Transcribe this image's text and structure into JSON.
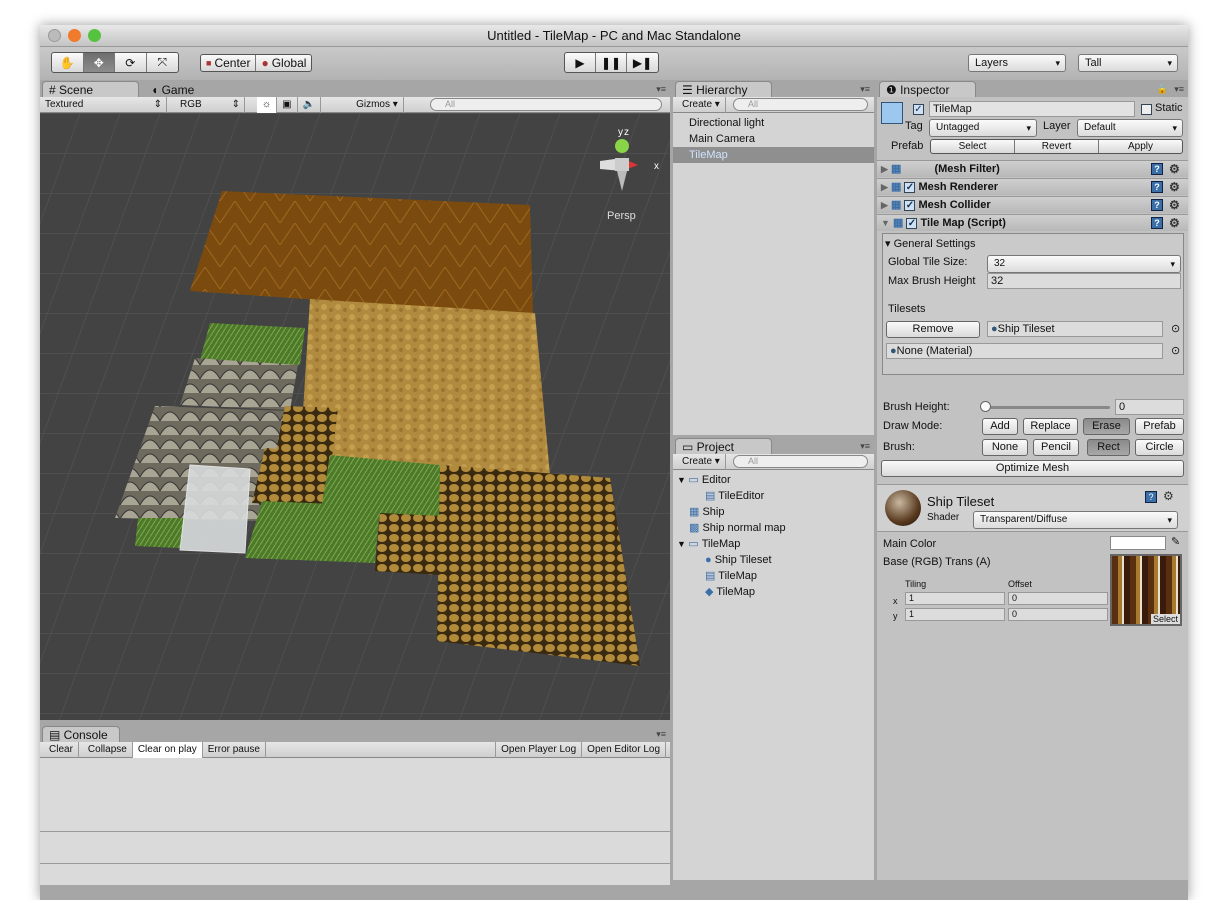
{
  "window": {
    "title": "Untitled - TileMap - PC and Mac Standalone"
  },
  "toolbar": {
    "tools": [
      "hand-tool",
      "move-tool",
      "rotate-tool",
      "scale-tool"
    ],
    "active_tool": "move-tool",
    "pivot": "Center",
    "space": "Global",
    "play": "play",
    "pause": "pause",
    "step": "step",
    "layers": "Layers",
    "layout": "Tall"
  },
  "scene": {
    "tabs": [
      {
        "label": "Scene",
        "active": true
      },
      {
        "label": "Game",
        "active": false
      }
    ],
    "render_mode": "Textured",
    "channel": "RGB",
    "gizmos": "Gizmos",
    "search_placeholder": "All",
    "view_label": "Persp",
    "gizmo_axes": {
      "y": "y",
      "z": "z",
      "x": "x"
    }
  },
  "console": {
    "tab": "Console",
    "buttons": [
      "Clear",
      "Collapse",
      "Clear on play",
      "Error pause"
    ],
    "active_button": "Clear on play",
    "right_buttons": [
      "Open Player Log",
      "Open Editor Log"
    ]
  },
  "hierarchy": {
    "tab": "Hierarchy",
    "create": "Create",
    "search_placeholder": "All",
    "items": [
      {
        "label": "Directional light",
        "selected": false
      },
      {
        "label": "Main Camera",
        "selected": false
      },
      {
        "label": "TileMap",
        "selected": true
      }
    ]
  },
  "project": {
    "tab": "Project",
    "create": "Create",
    "search_placeholder": "All",
    "items": [
      {
        "label": "Editor",
        "icon": "folder-icon",
        "indent": 0,
        "expanded": true
      },
      {
        "label": "TileEditor",
        "icon": "script-icon",
        "indent": 1
      },
      {
        "label": "Ship",
        "icon": "texture-icon",
        "indent": 0
      },
      {
        "label": "Ship normal map",
        "icon": "normal-map-icon",
        "indent": 0
      },
      {
        "label": "TileMap",
        "icon": "folder-icon",
        "indent": 0,
        "expanded": true
      },
      {
        "label": "Ship Tileset",
        "icon": "material-icon",
        "indent": 1
      },
      {
        "label": "TileMap",
        "icon": "script-icon",
        "indent": 1
      },
      {
        "label": "TileMap",
        "icon": "prefab-icon",
        "indent": 1
      }
    ]
  },
  "inspector": {
    "tab": "Inspector",
    "object_name": "TileMap",
    "active": true,
    "static_label": "Static",
    "static": false,
    "tag_label": "Tag",
    "tag": "Untagged",
    "layer_label": "Layer",
    "layer": "Default",
    "prefab_label": "Prefab",
    "prefab_buttons": [
      "Select",
      "Revert",
      "Apply"
    ],
    "components": [
      {
        "name": "(Mesh Filter)",
        "checkbox": false,
        "expanded": false
      },
      {
        "name": "Mesh Renderer",
        "checkbox": true,
        "expanded": false
      },
      {
        "name": "Mesh Collider",
        "checkbox": true,
        "expanded": false
      },
      {
        "name": "Tile Map (Script)",
        "checkbox": true,
        "expanded": true
      }
    ],
    "general_settings": "General Settings",
    "global_tile_size_label": "Global Tile Size:",
    "global_tile_size": "32",
    "max_brush_height_label": "Max Brush Height",
    "max_brush_height": "32",
    "tilesets_label": "Tilesets",
    "remove": "Remove",
    "tileset_1": "Ship Tileset",
    "tileset_2": "None (Material)",
    "brush_height_label": "Brush Height:",
    "brush_height": "0",
    "draw_mode_label": "Draw Mode:",
    "draw_modes": [
      "Add",
      "Replace",
      "Erase",
      "Prefab"
    ],
    "active_draw_mode": "Erase",
    "brush_label": "Brush:",
    "brushes": [
      "None",
      "Pencil",
      "Rect",
      "Circle"
    ],
    "active_brush": "Rect",
    "optimize": "Optimize Mesh",
    "material": {
      "name": "Ship Tileset",
      "shader_label": "Shader",
      "shader": "Transparent/Diffuse",
      "main_color_label": "Main Color",
      "main_color": "#ffffff",
      "base_label": "Base (RGB) Trans (A)",
      "tiling_label": "Tiling",
      "offset_label": "Offset",
      "x_label": "x",
      "y_label": "y",
      "tiling_x": "1",
      "tiling_y": "1",
      "offset_x": "0",
      "offset_y": "0",
      "select": "Select"
    }
  }
}
